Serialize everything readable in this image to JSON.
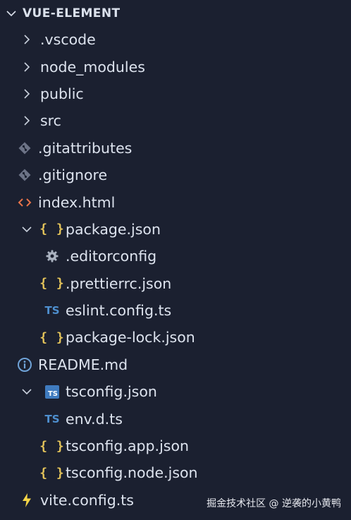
{
  "explorer": {
    "root_title": "VUE-ELEMENT"
  },
  "tree": {
    "vscode": ".vscode",
    "node_modules": "node_modules",
    "public": "public",
    "src": "src",
    "gitattributes": ".gitattributes",
    "gitignore": ".gitignore",
    "index_html": "index.html",
    "package_json": "package.json",
    "editorconfig": ".editorconfig",
    "prettierrc": ".prettierrc.json",
    "eslint_config": "eslint.config.ts",
    "package_lock": "package-lock.json",
    "readme": "README.md",
    "tsconfig": "tsconfig.json",
    "env_d_ts": "env.d.ts",
    "tsconfig_app": "tsconfig.app.json",
    "tsconfig_node": "tsconfig.node.json",
    "vite_config": "vite.config.ts"
  },
  "icons": {
    "json": "{ }",
    "ts": "TS",
    "ts_box": "TS"
  },
  "colors": {
    "background": "#1b2030",
    "json_icon": "#e3c35a",
    "ts_icon": "#4e8fcf",
    "html_icon": "#e8734a",
    "git_icon": "#6c7386",
    "vite_icon": "#f5d547",
    "readme_icon": "#6fa3d8"
  },
  "watermark": "掘金技术社区 @ 逆袭的小黄鸭"
}
